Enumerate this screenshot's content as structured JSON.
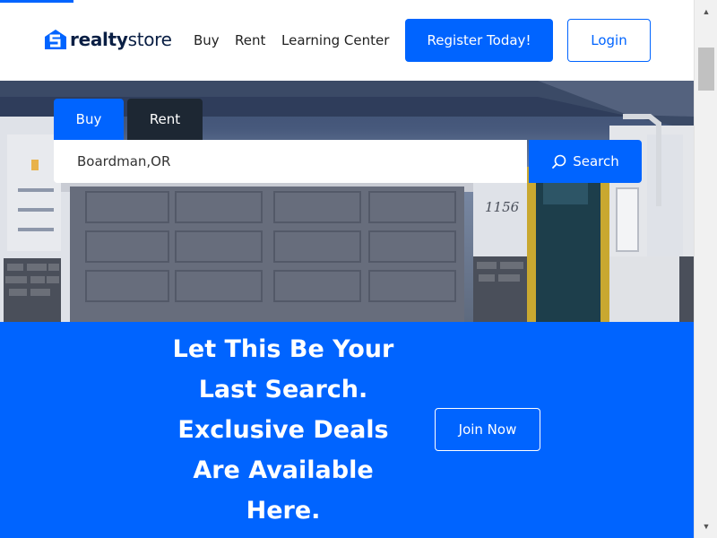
{
  "brand": {
    "name_bold": "realty",
    "name_light": "store"
  },
  "nav": {
    "buy": "Buy",
    "rent": "Rent",
    "learning": "Learning Center"
  },
  "header": {
    "register_label": "Register Today!",
    "login_label": "Login"
  },
  "search": {
    "tab_buy": "Buy",
    "tab_rent": "Rent",
    "value": "Boardman,OR",
    "button_label": "Search"
  },
  "hero": {
    "house_number": "1156"
  },
  "promo": {
    "headline": "Let This Be Your Last Search. Exclusive Deals Are Available Here.",
    "join_label": "Join Now"
  },
  "colors": {
    "accent": "#0064ff",
    "dark": "#1d2733"
  },
  "icons": {
    "logo": "house-s-logo-icon",
    "search": "search-icon",
    "scroll_up": "arrow-up-icon",
    "scroll_down": "arrow-down-icon"
  }
}
